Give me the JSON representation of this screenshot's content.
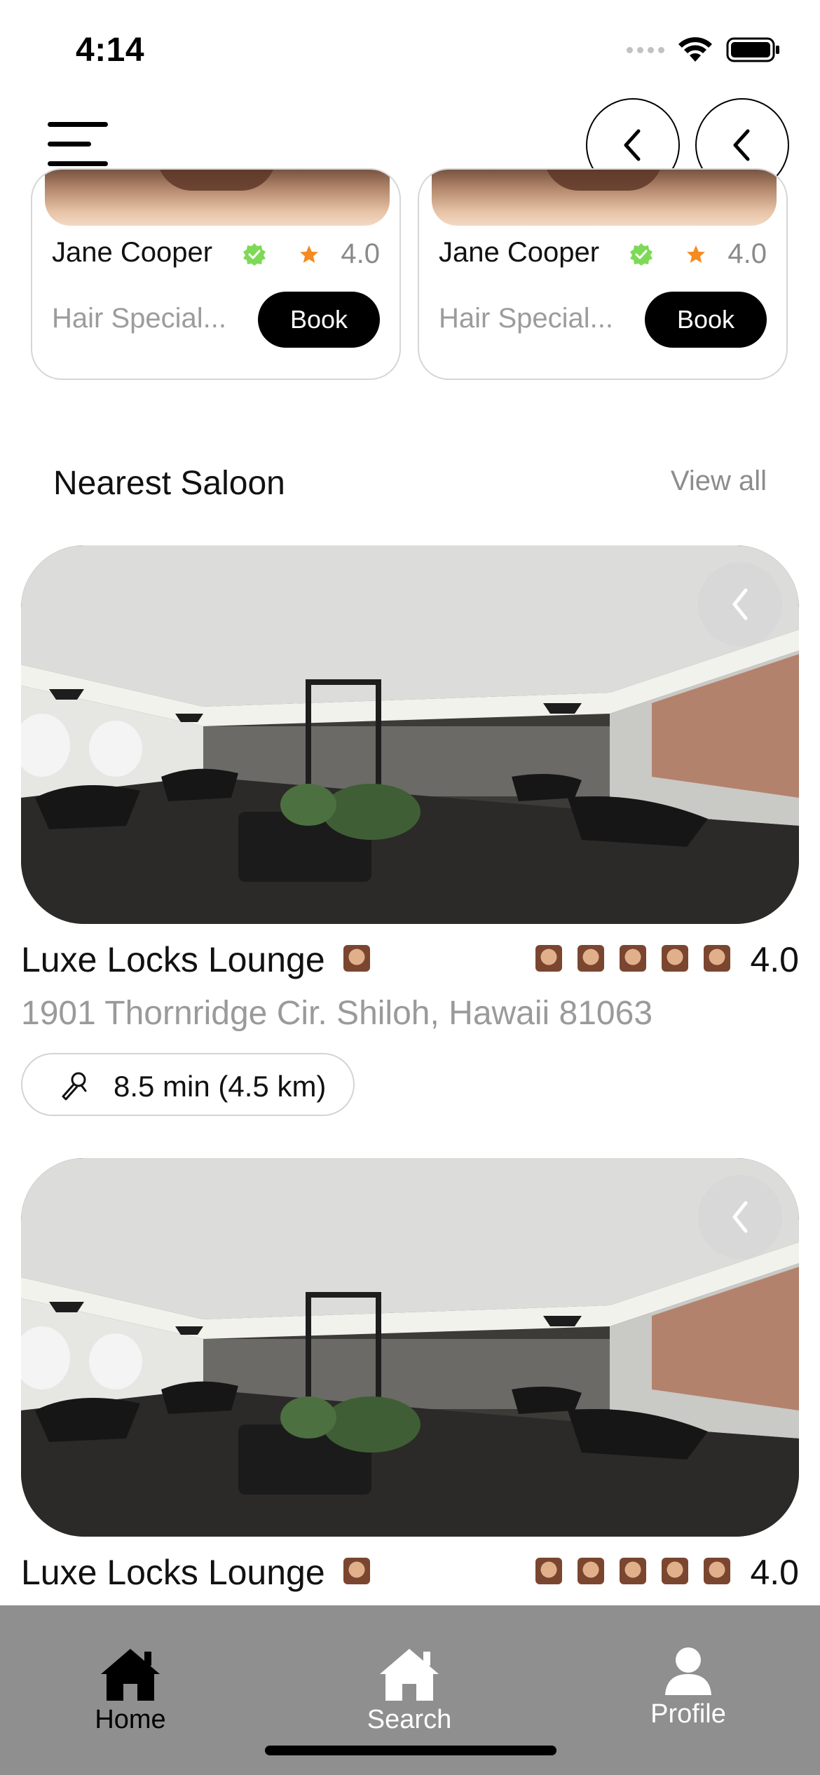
{
  "status_bar": {
    "time": "4:14"
  },
  "header": {
    "menu_icon": "hamburger-menu-icon",
    "prev_icon": "chevron-left-icon",
    "next_icon": "chevron-left-icon"
  },
  "specialists": [
    {
      "name": "Jane Cooper",
      "role": "Hair Special...",
      "rating": "4.0",
      "book_label": "Book",
      "verified_color": "#7ed957",
      "star_color": "#f58a1f"
    },
    {
      "name": "Jane Cooper",
      "role": "Hair Special...",
      "rating": "4.0",
      "book_label": "Book",
      "verified_color": "#7ed957",
      "star_color": "#f58a1f"
    }
  ],
  "nearest": {
    "title": "Nearest Saloon",
    "view_all": "View all",
    "salons": [
      {
        "name": "Luxe Locks Lounge",
        "rating": "4.0",
        "star_count": 5,
        "address": "1901 Thornridge Cir. Shiloh, Hawaii 81063",
        "distance": "8.5 min (4.5 km)"
      },
      {
        "name": "Luxe Locks Lounge",
        "rating": "4.0",
        "star_count": 5
      }
    ]
  },
  "tab_bar": {
    "tabs": [
      {
        "label": "Home",
        "icon": "home-icon",
        "active": true
      },
      {
        "label": "Search",
        "icon": "home-icon",
        "active": false
      },
      {
        "label": "Profile",
        "icon": "person-icon",
        "active": false
      }
    ],
    "background": "#8f8f8f"
  }
}
